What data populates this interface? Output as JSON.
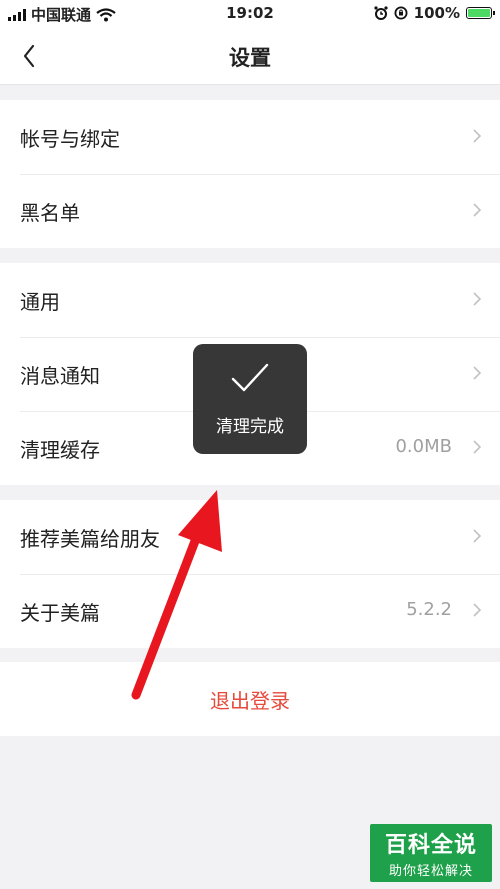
{
  "status_bar": {
    "carrier": "中国联通",
    "time": "19:02",
    "battery": "100%",
    "battery_level": 1.0,
    "icons": [
      "signal-icon",
      "wifi-icon",
      "alarm-icon",
      "orientation-lock-icon",
      "battery-icon"
    ]
  },
  "navbar": {
    "title": "设置",
    "back_icon": "chevron-left-icon"
  },
  "groups": [
    {
      "items": [
        {
          "label": "帐号与绑定"
        },
        {
          "label": "黑名单"
        }
      ]
    },
    {
      "items": [
        {
          "label": "通用"
        },
        {
          "label": "消息通知"
        },
        {
          "label": "清理缓存",
          "value": "0.0MB"
        }
      ]
    },
    {
      "items": [
        {
          "label": "推荐美篇给朋友"
        },
        {
          "label": "关于美篇",
          "value": "5.2.2"
        }
      ]
    }
  ],
  "logout": {
    "label": "退出登录"
  },
  "toast": {
    "text": "清理完成",
    "icon": "checkmark-icon"
  },
  "annotation": {
    "icon": "red-arrow-icon"
  },
  "watermark": {
    "title": "百科全说",
    "subtitle": "助你轻松解决"
  },
  "colors": {
    "accent": "#e64a3b",
    "background": "#f2f2f4",
    "toast_bg": "#262626",
    "watermark": "#1fa04a",
    "arrow": "#e8161e"
  }
}
